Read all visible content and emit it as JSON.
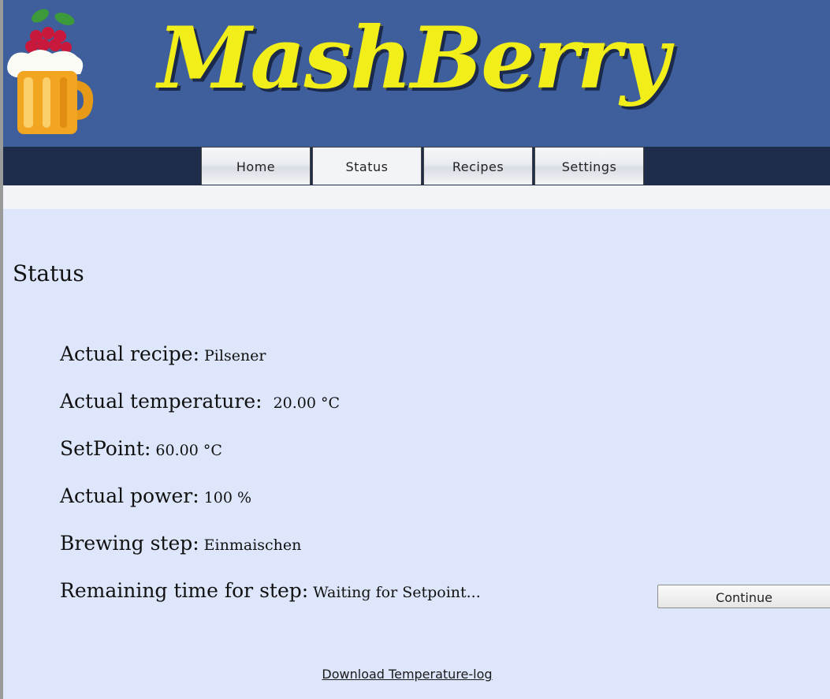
{
  "header": {
    "brand_name": "MashBerry",
    "logo_icon": "raspberry-beer-mug-icon"
  },
  "nav": {
    "tabs": [
      {
        "label": "Home",
        "active": false
      },
      {
        "label": "Status",
        "active": true
      },
      {
        "label": "Recipes",
        "active": false
      },
      {
        "label": "Settings",
        "active": false
      }
    ]
  },
  "main": {
    "title": "Status",
    "fields": {
      "recipe": {
        "label": "Actual recipe:",
        "value": "Pilsener"
      },
      "temperature": {
        "label": "Actual temperature:",
        "value": "20.00 °C"
      },
      "setpoint": {
        "label": "SetPoint:",
        "value": "60.00 °C"
      },
      "power": {
        "label": "Actual power:",
        "value": "100 %"
      },
      "step": {
        "label": "Brewing step:",
        "value": "Einmaischen"
      },
      "remaining": {
        "label": "Remaining time for step:",
        "value": "Waiting for Setpoint..."
      }
    },
    "continue_label": "Continue",
    "download_label": "Download Temperature-log"
  },
  "colors": {
    "header_bg": "#3e5f9c",
    "nav_bar_bg": "#1f2d4d",
    "page_bg": "#dde6fb",
    "brand_text": "#f2ee1a"
  }
}
